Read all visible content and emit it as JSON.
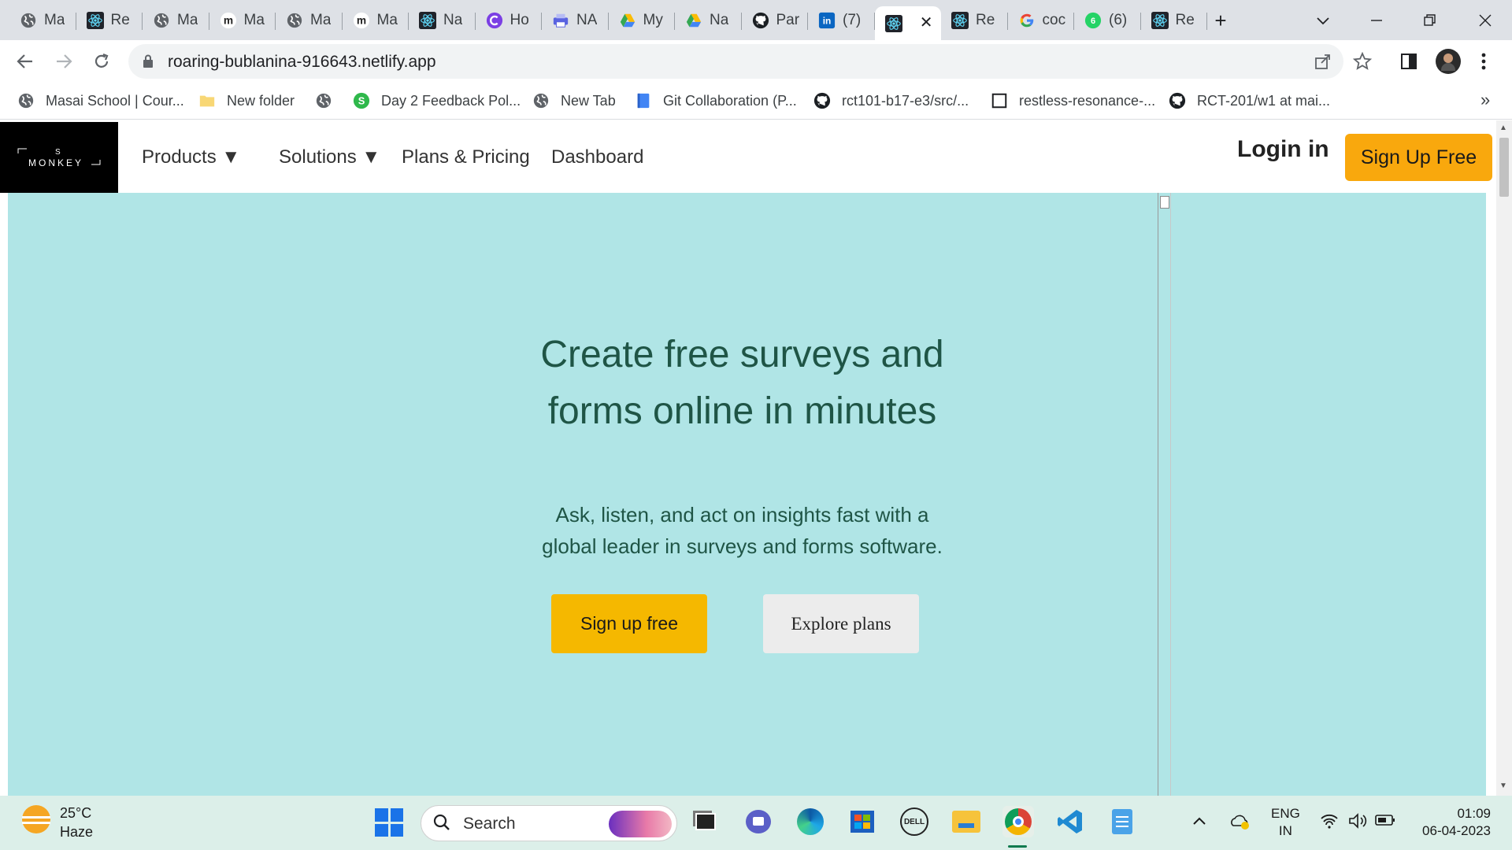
{
  "browser": {
    "tabs": [
      {
        "title": "Ma",
        "icon": "globe-icon"
      },
      {
        "title": "Re",
        "icon": "react-icon"
      },
      {
        "title": "Ma",
        "icon": "globe-icon"
      },
      {
        "title": "Ma",
        "icon": "m-logo-icon"
      },
      {
        "title": "Ma",
        "icon": "globe-icon"
      },
      {
        "title": "Ma",
        "icon": "m-logo-icon"
      },
      {
        "title": "Na",
        "icon": "react-icon"
      },
      {
        "title": "Ho",
        "icon": "c-logo-icon"
      },
      {
        "title": "NA",
        "icon": "printer-icon"
      },
      {
        "title": "My",
        "icon": "google-drive-icon"
      },
      {
        "title": "Na",
        "icon": "google-drive-icon"
      },
      {
        "title": "Par",
        "icon": "github-icon"
      },
      {
        "title": "(7)",
        "icon": "linkedin-icon"
      },
      {
        "title": "",
        "icon": "react-icon",
        "active": true
      },
      {
        "title": "Re",
        "icon": "react-icon"
      },
      {
        "title": "coc",
        "icon": "google-icon"
      },
      {
        "title": "(6)",
        "icon": "whatsapp-icon"
      },
      {
        "title": "Re",
        "icon": "react-icon"
      }
    ],
    "new_tab": "+",
    "url": "roaring-bublanina-916643.netlify.app",
    "bookmarks": [
      {
        "label": "Masai School | Cour...",
        "icon": "globe-icon"
      },
      {
        "label": "New folder",
        "icon": "folder-icon"
      },
      {
        "label": "",
        "icon": "globe-icon"
      },
      {
        "label": "Day 2 Feedback Pol...",
        "icon": "s-logo-icon"
      },
      {
        "label": "New Tab",
        "icon": "globe-icon"
      },
      {
        "label": "Git Collaboration (P...",
        "icon": "book-icon"
      },
      {
        "label": "rct101-b17-e3/src/...",
        "icon": "github-icon"
      },
      {
        "label": "restless-resonance-...",
        "icon": "square-icon"
      },
      {
        "label": "RCT-201/w1 at mai...",
        "icon": "github-icon"
      }
    ],
    "bookmarks_more": "»"
  },
  "site": {
    "logo_top": "S",
    "logo_bottom": "MONKEY",
    "nav": {
      "products": "Products ▼",
      "solutions": "Solutions ▼",
      "plans": "Plans & Pricing",
      "dashboard": "Dashboard"
    },
    "login": "Login in",
    "signup_top": "Sign Up Free",
    "hero": {
      "heading": "Create free surveys and forms online in minutes",
      "subheading": "Ask, listen, and act on insights fast with a global leader in surveys and forms software.",
      "cta_primary": "Sign up free",
      "cta_secondary": "Explore plans",
      "background": "#b0e5e6",
      "text_color": "#1f5546"
    },
    "accent": "#f9a80d"
  },
  "taskbar": {
    "weather_temp": "25°C",
    "weather_desc": "Haze",
    "search_placeholder": "Search",
    "lang_line1": "ENG",
    "lang_line2": "IN",
    "time": "01:09",
    "date": "06-04-2023"
  }
}
